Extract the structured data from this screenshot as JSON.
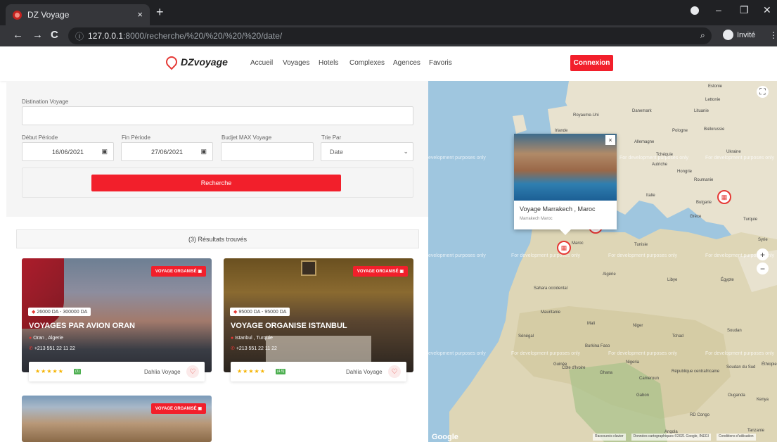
{
  "browser": {
    "tab_title": "DZ Voyage",
    "tab_close": "×",
    "new_tab": "+",
    "url_host": "127.0.0.1",
    "url_path": ":8000/recherche/%20/%20/%20/%20/date/",
    "profile_label": "Invité",
    "win_min": "–",
    "win_restore": "❐",
    "win_close": "✕"
  },
  "header": {
    "logo": "DZvoyage",
    "nav": [
      "Accueil",
      "Voyages",
      "Hotels",
      "Complexes",
      "Agences",
      "Favoris"
    ],
    "login": "Connexion"
  },
  "search": {
    "destination_label": "Distination Voyage",
    "destination_value": "",
    "start_label": "Début Période",
    "start_value": "16/06/2021",
    "end_label": "Fin Période",
    "end_value": "27/06/2021",
    "budget_label": "Budjet MAX Voyage",
    "budget_value": "",
    "sort_label": "Trie Par",
    "sort_value": "Date",
    "button": "Recherche"
  },
  "results": {
    "count_text": "(3) Résultats trouvés",
    "cards": [
      {
        "badge": "VOYAGE ORGANISÉ",
        "price": "26000 DA - 300000 DA",
        "title": "VOYAGES PAR AVION ORAN",
        "location": "Oran , Algerie",
        "phone": "+213 551 22 11 22",
        "stars": "★★★★★",
        "rating": "(3)",
        "agency": "Dahlia Voyage"
      },
      {
        "badge": "VOYAGE ORGANISÉ",
        "price": "95000 DA - 95000 DA",
        "title": "VOYAGE ORGANISE ISTANBUL",
        "location": "Istanbul , Turquie",
        "phone": "+213 551 22 11 22",
        "stars": "★★★★★",
        "rating": "(4.5)",
        "agency": "Dahlia Voyage"
      },
      {
        "badge": "VOYAGE ORGANISÉ"
      }
    ]
  },
  "map": {
    "popup_title": "Voyage Marrakech , Maroc",
    "popup_subtitle": "Marrakech Maroc",
    "popup_close": "×",
    "dev_text": "For development purposes only",
    "dev_text_cut": "evelopment purposes only",
    "google": "Google",
    "footer_items": [
      "Raccourcis clavier",
      "Données cartographiques ©2021 Google, INEGI",
      "Conditions d'utilisation"
    ],
    "labels": [
      "Estonie",
      "Lettonie",
      "Lituanie",
      "Royaume-Uni",
      "Danemark",
      "Irlande",
      "Biélorussie",
      "Pologne",
      "Allemagne",
      "Tchéquie",
      "Ukraine",
      "Autriche",
      "Hongrie",
      "Roumanie",
      "Italie",
      "Bulgarie",
      "Grèce",
      "Turquie",
      "Syrie",
      "Tunisie",
      "Maroc",
      "Algérie",
      "Libye",
      "Égypte",
      "Sahara occidental",
      "Mauritanie",
      "Mali",
      "Niger",
      "Tchad",
      "Soudan",
      "Sénégal",
      "Burkina Faso",
      "Guinée",
      "Nigeria",
      "Côte d'Ivoire",
      "Ghana",
      "Cameroun",
      "République centrafricaine",
      "Soudan du Sud",
      "Éthiopie",
      "Ouganda",
      "Kenya",
      "Gabon",
      "RD Congo",
      "Tanzanie",
      "Angola"
    ]
  }
}
